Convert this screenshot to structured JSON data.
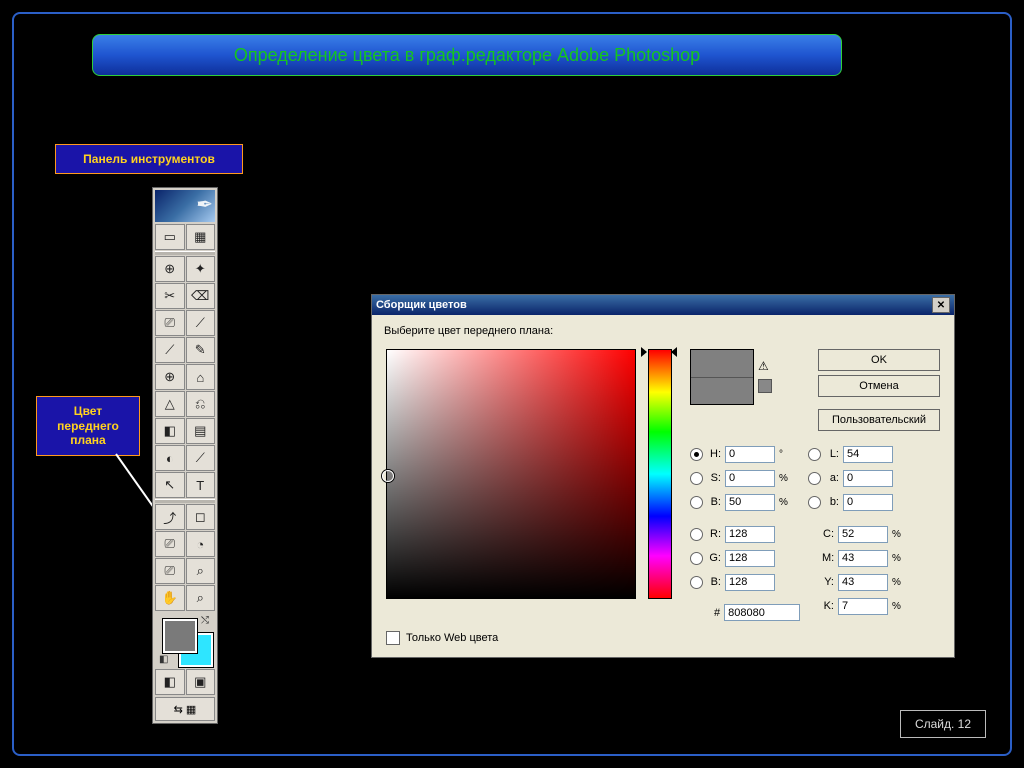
{
  "title": "Определение цвета в граф.редакторе Adobe Photoshop",
  "labels": {
    "tools_panel": "Панель инструментов",
    "fg_color": "Цвет переднего плана"
  },
  "slide": "Слайд. 12",
  "toolbar": {
    "icons": [
      "▭",
      "▦",
      "⊕",
      "✦",
      "✂",
      "⌫",
      "⎚",
      "⟋",
      "⟋",
      "✎",
      "⊕",
      "⌂",
      "△",
      "⎌",
      "◧",
      "▤",
      "◐",
      "⟋",
      "↖",
      "T",
      "⤴",
      "◻",
      "⎚",
      "◔",
      "⎚",
      "⌕",
      "✋",
      "⌕"
    ],
    "footer": [
      "◧",
      "▣"
    ],
    "jump": "⇆ ▦"
  },
  "dialog": {
    "title": "Сборщик цветов",
    "instruction": "Выберите цвет переднего плана:",
    "ok": "OK",
    "cancel": "Отмена",
    "custom": "Пользовательский",
    "web_only": "Только Web цвета",
    "hex": "808080",
    "hsb": {
      "h": "0",
      "s": "0",
      "b": "50"
    },
    "lab": {
      "l": "54",
      "a": "0",
      "b": "0"
    },
    "rgb": {
      "r": "128",
      "g": "128",
      "b": "128"
    },
    "cmyk": {
      "c": "52",
      "m": "43",
      "y": "43",
      "k": "7"
    },
    "labels": {
      "H": "H:",
      "S": "S:",
      "B": "B:",
      "L": "L:",
      "a": "a:",
      "b2": "b:",
      "R": "R:",
      "G": "G:",
      "Bl": "B:",
      "C": "C:",
      "M": "M:",
      "Y": "Y:",
      "K": "K:",
      "deg": "°",
      "pct": "%",
      "hash": "#"
    }
  }
}
